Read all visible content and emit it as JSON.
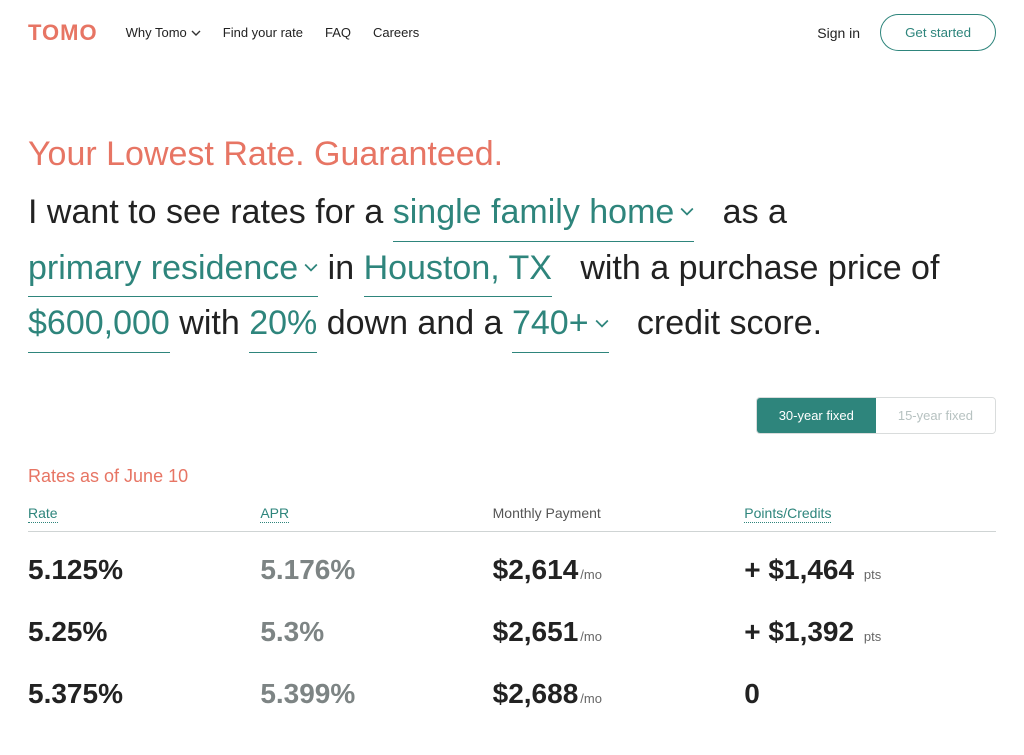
{
  "brand": "TOMO",
  "nav": {
    "items": [
      "Why Tomo",
      "Find your rate",
      "FAQ",
      "Careers"
    ],
    "signin": "Sign in",
    "get_started": "Get started"
  },
  "headline": "Your Lowest Rate. Guaranteed.",
  "sentence": {
    "t1": "I want to see rates for a ",
    "property_type": "single family home",
    "t2": " as a ",
    "occupancy": "primary residence",
    "t3": " in ",
    "location": "Houston, TX",
    "t4": " with a purchase price of ",
    "price": "$600,000",
    "t5": " with ",
    "down": "20%",
    "t6": " down and a ",
    "score": "740+",
    "t7": " credit score."
  },
  "tabs": {
    "a": "30-year fixed",
    "b": "15-year fixed",
    "active": "a"
  },
  "asof": "Rates as of June 10",
  "columns": {
    "rate": "Rate",
    "apr": "APR",
    "monthly": "Monthly Payment",
    "points": "Points/Credits"
  },
  "rows": [
    {
      "rate": "5.125%",
      "apr": "5.176%",
      "monthly": "$2,614",
      "msuf": "/mo",
      "points": "+ $1,464",
      "psuf": "pts"
    },
    {
      "rate": "5.25%",
      "apr": "5.3%",
      "monthly": "$2,651",
      "msuf": "/mo",
      "points": "+ $1,392",
      "psuf": "pts"
    },
    {
      "rate": "5.375%",
      "apr": "5.399%",
      "monthly": "$2,688",
      "msuf": "/mo",
      "points": "0",
      "psuf": ""
    }
  ]
}
